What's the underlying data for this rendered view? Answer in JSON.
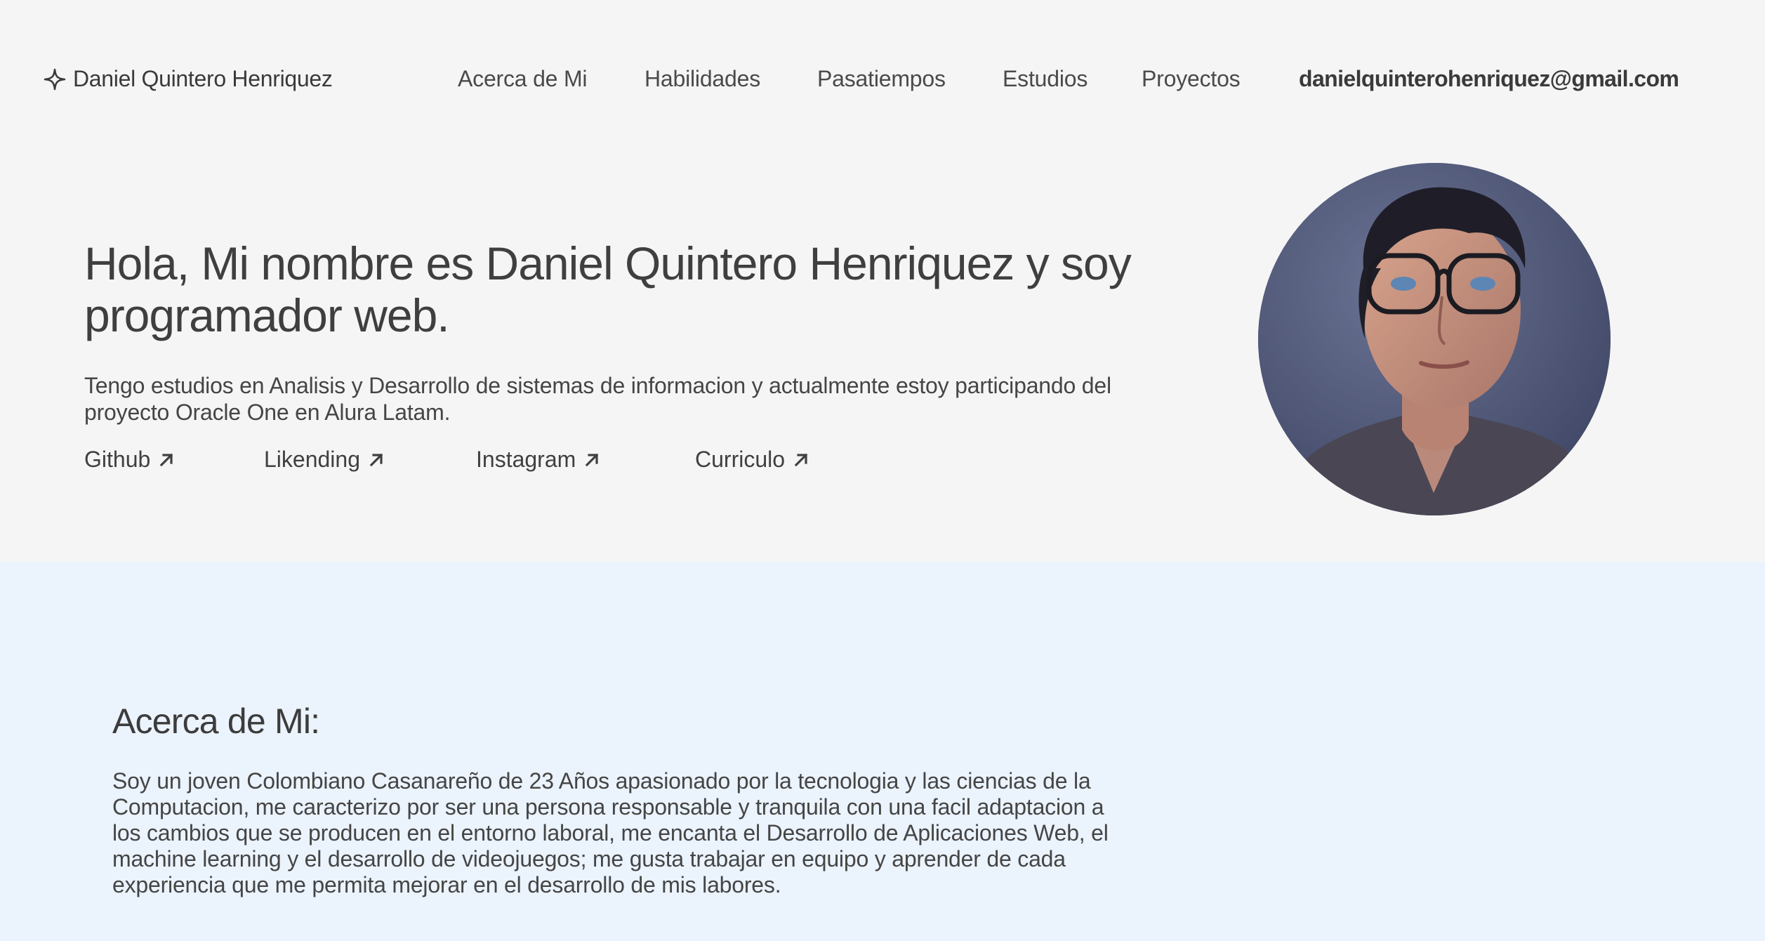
{
  "header": {
    "brand_icon": "sparkle-icon",
    "brand_name": "Daniel Quintero Henriquez",
    "nav": [
      {
        "label": "Acerca de Mi"
      },
      {
        "label": "Habilidades"
      },
      {
        "label": "Pasatiempos"
      },
      {
        "label": "Estudios"
      },
      {
        "label": "Proyectos"
      }
    ],
    "email": "danielquinterohenriquez@gmail.com"
  },
  "hero": {
    "title": "Hola, Mi nombre es Daniel Quintero Henriquez y soy programador web.",
    "description": "Tengo estudios en Analisis y Desarrollo de sistemas de informacion y actualmente estoy participando del proyecto Oracle One en Alura Latam.",
    "links": [
      {
        "label": "Github",
        "icon": "arrow-up-right-icon"
      },
      {
        "label": "Likending",
        "icon": "arrow-up-right-icon"
      },
      {
        "label": "Instagram",
        "icon": "arrow-up-right-icon"
      },
      {
        "label": "Curriculo",
        "icon": "arrow-up-right-icon"
      }
    ],
    "avatar_icon": "profile-photo"
  },
  "about": {
    "title": "Acerca de Mi:",
    "text": "Soy un joven Colombiano Casanareño de 23 Años apasionado por la tecnologia y las ciencias de la Computacion, me caracterizo por ser una persona responsable y tranquila con una facil adaptacion a los cambios que se producen en el entorno laboral, me encanta el Desarrollo de Aplicaciones Web, el machine learning y el desarrollo de videojuegos; me gusta trabajar en equipo y aprender de cada experiencia que me permita mejorar en el desarrollo de mis labores."
  },
  "colors": {
    "hero_background": "#f5f5f5",
    "about_background": "#ebf3fd",
    "text": "#3b3b3b"
  }
}
